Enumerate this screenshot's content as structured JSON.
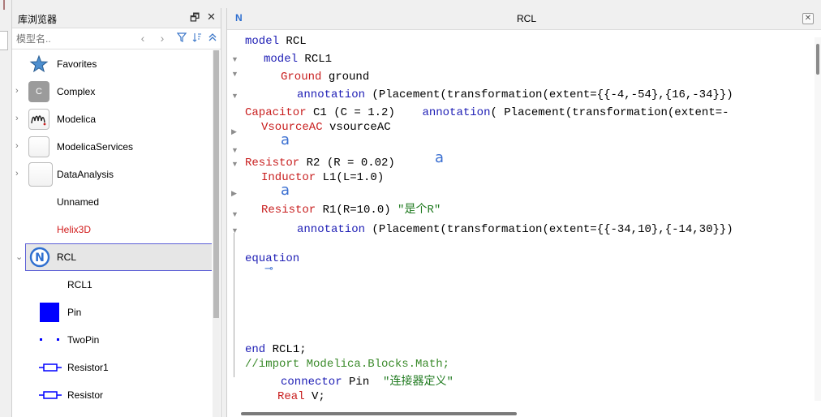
{
  "library": {
    "title": "库浏览器",
    "float_btn": "🗗",
    "close_btn": "✕",
    "search": {
      "placeholder": "模型名..",
      "value": ""
    },
    "items": [
      {
        "label": "Favorites",
        "icon": "star-icon"
      },
      {
        "label": "Complex",
        "icon": "complex-package-icon",
        "icon_text": "C"
      },
      {
        "label": "Modelica",
        "icon": "modelica-logo-icon"
      },
      {
        "label": "ModelicaServices",
        "icon": "package-icon"
      },
      {
        "label": "DataAnalysis",
        "icon": "package-icon"
      },
      {
        "label": "Unnamed",
        "icon": "none"
      },
      {
        "label": "Helix3D",
        "icon": "none"
      },
      {
        "label": "RCL",
        "icon": "n-circle-icon"
      },
      {
        "label": "RCL1",
        "icon": "none"
      },
      {
        "label": "Pin",
        "icon": "blue-square-icon"
      },
      {
        "label": "TwoPin",
        "icon": "two-dots-icon"
      },
      {
        "label": "Resistor1",
        "icon": "resistor-icon"
      },
      {
        "label": "Resistor",
        "icon": "resistor-icon"
      }
    ],
    "colors": {
      "helix": "#d11a1a",
      "selected_border": "#5c5fd6",
      "pin": "#0000ff"
    }
  },
  "editor": {
    "title": "RCL",
    "close_btn": "✕",
    "tab_icon": "N",
    "code": {
      "l1a": "model",
      "l1b": " RCL",
      "l2a": "model",
      "l2b": " RCL1",
      "l3a": "Ground",
      "l3b": " ground",
      "l4a": "annotation",
      "l4b": " (Placement(transformation(extent={{-4,-54},{16,-34}})",
      "l5a": "Capacitor",
      "l5b": " C1 (C = 1.2)    ",
      "l5c": "annotation",
      "l5d": "( Placement(transformation(extent=-",
      "l6a": "VsourceAC",
      "l6b": " vsourceAC",
      "l7a": "Resistor",
      "l7b": " R2 (R = 0.02)",
      "l8a": "Inductor",
      "l8b": " L1(L=1.0)",
      "l9a": "Resistor",
      "l9b": " R1(R=10.0) ",
      "l9c": "\"是个R\"",
      "l10a": "annotation",
      "l10b": " (Placement(transformation(extent={{-34,10},{-14,30}})",
      "l11": "equation",
      "l12a": "end",
      "l12b": " RCL1;",
      "l13": "//import Modelica.Blocks.Math;",
      "l14a": "connector",
      "l14b": " Pin  ",
      "l14c": "\"连接器定义\"",
      "l15a": "Real",
      "l15b": " V;"
    },
    "markers": {
      "annotation_glyph": "a",
      "connect_glyph": "⊸"
    },
    "colors": {
      "keyword": "#1e1eb5",
      "type": "#c81e1e",
      "string": "#1f7a1f",
      "comment": "#3a8a2a"
    }
  }
}
